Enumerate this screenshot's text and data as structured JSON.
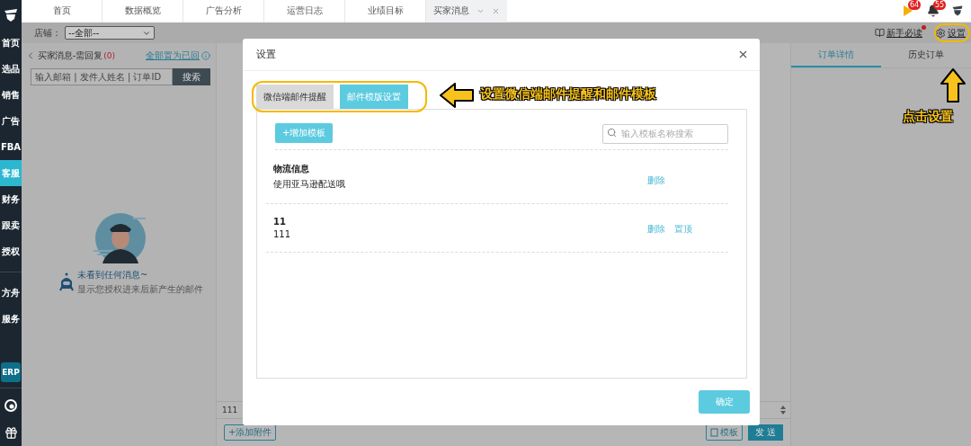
{
  "sidebar": {
    "sections": [
      {
        "items": [
          {
            "label": "首页",
            "selected": false
          },
          {
            "label": "选品",
            "selected": false
          },
          {
            "label": "销售",
            "selected": false
          },
          {
            "label": "广告",
            "selected": false
          },
          {
            "label": "FBA",
            "selected": false
          },
          {
            "label": "客服",
            "selected": true
          },
          {
            "label": "财务",
            "selected": false
          },
          {
            "label": "跟卖",
            "selected": false
          },
          {
            "label": "授权",
            "selected": false
          }
        ]
      },
      {
        "items": [
          {
            "label": "方舟",
            "selected": false
          },
          {
            "label": "服务",
            "selected": false
          }
        ]
      }
    ],
    "erp": "ERP"
  },
  "top_tabs": [
    {
      "label": "首页",
      "selected": false
    },
    {
      "label": "数据概览",
      "selected": false
    },
    {
      "label": "广告分析",
      "selected": false
    },
    {
      "label": "运营日志",
      "selected": false
    },
    {
      "label": "业绩目标",
      "selected": false
    },
    {
      "label": "买家消息",
      "selected": true
    }
  ],
  "notifications": [
    {
      "kind": "flag",
      "count": "64"
    },
    {
      "kind": "bell",
      "count": "55"
    }
  ],
  "toolbar": {
    "store_label": "店铺：",
    "store_value": "--全部--",
    "guide_link": "新手必读",
    "settings_link": "设置"
  },
  "message_panel": {
    "title": "买家消息-需回复",
    "count": "(0)",
    "mark_all": "全部置为已回",
    "search_placeholder": "输入邮箱 | 发件人姓名 | 订单ID",
    "search_button": "搜索",
    "empty_title": "未看到任何消息~",
    "empty_hint": "显示您授权进来后新产生的邮件"
  },
  "composer": {
    "value": "111",
    "attach_button": "+添加附件",
    "template_button": "模板",
    "send_button": "发 送"
  },
  "detail_tabs": [
    {
      "label": "订单详情",
      "selected": true
    },
    {
      "label": "历史订单",
      "selected": false
    }
  ],
  "dialog": {
    "title": "设置",
    "tabs": [
      {
        "label": "微信端邮件提醒",
        "selected": false
      },
      {
        "label": "邮件模版设置",
        "selected": true
      }
    ],
    "add_button": "+增加模板",
    "search_placeholder": "输入模板名称搜索",
    "templates": [
      {
        "name": "物流信息",
        "body": "使用亚马逊配送哦",
        "actions": [
          "删除"
        ]
      },
      {
        "name": "11",
        "body": "111",
        "actions": [
          "删除",
          "置顶"
        ]
      }
    ],
    "confirm_button": "确定"
  },
  "annotations": [
    {
      "kind": "left",
      "text": "设置微信端邮件提醒和邮件模板"
    },
    {
      "kind": "up",
      "text": "点击设置"
    }
  ]
}
